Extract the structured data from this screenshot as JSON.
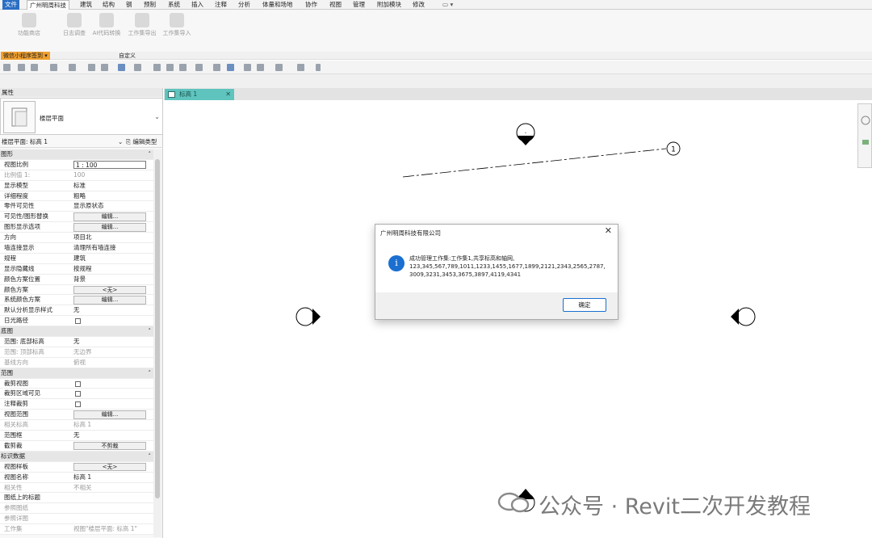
{
  "ribbon": {
    "tabs": [
      "文件",
      "广州明周科技",
      "建筑",
      "结构",
      "钢",
      "预制",
      "系统",
      "插入",
      "注释",
      "分析",
      "体量和场地",
      "协作",
      "视图",
      "管理",
      "附加模块",
      "修改"
    ],
    "buttons": [
      "功能商店",
      "日志调查",
      "AI代码转换",
      "工作集导出",
      "工作集导入"
    ],
    "panel_label_orange": "微信小程序签到 ▾",
    "panel_label_custom": "自定义"
  },
  "properties": {
    "title": "属性",
    "type_name": "楼层平面",
    "instance_filter": "楼层平面: 标高 1",
    "edit_type": "编辑类型",
    "rows": [
      {
        "kind": "cat",
        "k": "图形"
      },
      {
        "kind": "box",
        "k": "视图比例",
        "v": "1 : 100"
      },
      {
        "kind": "gray",
        "k": "比例值 1:",
        "v": "100"
      },
      {
        "kind": "text",
        "k": "显示模型",
        "v": "标准"
      },
      {
        "kind": "text",
        "k": "详细程度",
        "v": "粗略"
      },
      {
        "kind": "text",
        "k": "零件可见性",
        "v": "显示原状态"
      },
      {
        "kind": "btn",
        "k": "可见性/图形替换",
        "v": "编辑..."
      },
      {
        "kind": "btn",
        "k": "图形显示选项",
        "v": "编辑..."
      },
      {
        "kind": "text",
        "k": "方向",
        "v": "项目北"
      },
      {
        "kind": "text",
        "k": "墙连接显示",
        "v": "清理所有墙连接"
      },
      {
        "kind": "text",
        "k": "规程",
        "v": "建筑"
      },
      {
        "kind": "text",
        "k": "显示隐藏线",
        "v": "按规程"
      },
      {
        "kind": "text",
        "k": "颜色方案位置",
        "v": "背景"
      },
      {
        "kind": "btn",
        "k": "颜色方案",
        "v": "<无>"
      },
      {
        "kind": "btn",
        "k": "系统颜色方案",
        "v": "编辑..."
      },
      {
        "kind": "text",
        "k": "默认分析显示样式",
        "v": "无"
      },
      {
        "kind": "chk",
        "k": "日光路径",
        "v": ""
      },
      {
        "kind": "cat",
        "k": "底图"
      },
      {
        "kind": "text",
        "k": "范围: 底部标高",
        "v": "无"
      },
      {
        "kind": "gray",
        "k": "范围: 顶部标高",
        "v": "无边界"
      },
      {
        "kind": "gray",
        "k": "基线方向",
        "v": "俯视"
      },
      {
        "kind": "cat",
        "k": "范围"
      },
      {
        "kind": "chk",
        "k": "裁剪视图",
        "v": ""
      },
      {
        "kind": "chk",
        "k": "裁剪区域可见",
        "v": ""
      },
      {
        "kind": "chk",
        "k": "注释裁剪",
        "v": ""
      },
      {
        "kind": "btn",
        "k": "视图范围",
        "v": "编辑..."
      },
      {
        "kind": "gray",
        "k": "相关标高",
        "v": "标高 1"
      },
      {
        "kind": "text",
        "k": "范围框",
        "v": "无"
      },
      {
        "kind": "btn",
        "k": "截剪裁",
        "v": "不剪裁"
      },
      {
        "kind": "cat",
        "k": "标识数据"
      },
      {
        "kind": "btn",
        "k": "视图样板",
        "v": "<无>"
      },
      {
        "kind": "text",
        "k": "视图名称",
        "v": "标高 1"
      },
      {
        "kind": "gray",
        "k": "相关性",
        "v": "不相关"
      },
      {
        "kind": "text",
        "k": "图纸上的标题",
        "v": ""
      },
      {
        "kind": "gray",
        "k": "参照图纸",
        "v": ""
      },
      {
        "kind": "gray",
        "k": "参照详图",
        "v": ""
      },
      {
        "kind": "gray",
        "k": "工作集",
        "v": "视图\"楼层平面: 标高 1\""
      }
    ]
  },
  "view": {
    "tab_label": "标高 1",
    "grid_label": "1"
  },
  "dialog": {
    "title": "广州明周科技有限公司",
    "message_line1": "成功管理工作集:工作集1,共享标高和轴网,",
    "message_line2": "123,345,567,789,1011,1233,1455,1677,1899,2121,2343,2565,2787,",
    "message_line3": "3009,3231,3453,3675,3897,4119,4341",
    "ok_label": "确定",
    "info_glyph": "i",
    "close_glyph": "✕"
  },
  "watermark": {
    "text": "公众号 · Revit二次开发教程"
  },
  "colors": {
    "accent": "#1a6fd0",
    "view_tab": "#5ec4bd",
    "panel_orange": "#f0a030"
  }
}
